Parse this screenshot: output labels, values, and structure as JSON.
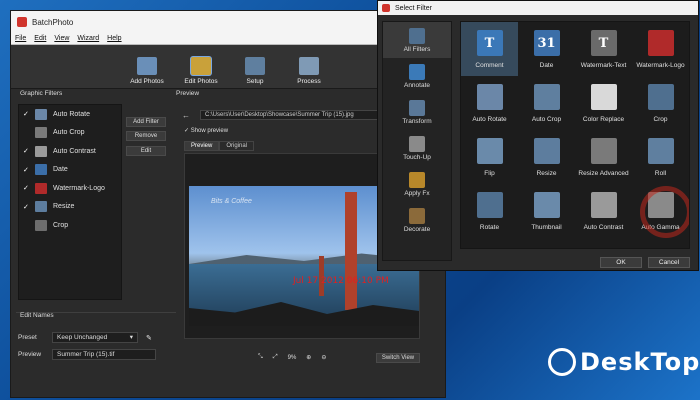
{
  "main_window": {
    "title": "BatchPhoto",
    "menu": [
      "File",
      "Edit",
      "View",
      "Wizard",
      "Help"
    ],
    "toolbar": [
      {
        "label": "Add Photos",
        "icon": "add-photos-icon",
        "color": "#6a8fb8"
      },
      {
        "label": "Edit Photos",
        "icon": "edit-photos-icon",
        "color": "#c9a13a",
        "active": true
      },
      {
        "label": "Setup",
        "icon": "setup-icon",
        "color": "#5f7f9f"
      },
      {
        "label": "Process",
        "icon": "process-icon",
        "color": "#7f9ab5"
      }
    ],
    "graphic_filters_label": "Graphic Filters",
    "filters": [
      {
        "checked": true,
        "name": "Auto Rotate",
        "color": "#6b87a8"
      },
      {
        "checked": false,
        "name": "Auto Crop",
        "color": "#7a7a7a"
      },
      {
        "checked": true,
        "name": "Auto Contrast",
        "color": "#9a9a9a"
      },
      {
        "checked": true,
        "name": "Date",
        "color": "#3b6ea8"
      },
      {
        "checked": true,
        "name": "Watermark-Logo",
        "color": "#b02a2a"
      },
      {
        "checked": true,
        "name": "Resize",
        "color": "#5d7d9e"
      },
      {
        "checked": false,
        "name": "Crop",
        "color": "#6d6d6d"
      }
    ],
    "buttons": {
      "add_filter": "Add Filter",
      "remove": "Remove",
      "edit": "Edit"
    },
    "preview_label": "Preview",
    "path": "C:\\Users\\User\\Desktop\\Showcase\\Summer Trip (15).jpg",
    "show_preview": "Show preview",
    "tabs": [
      "Preview",
      "Original"
    ],
    "photo_watermark": "Bits & Coffee",
    "photo_date": "Jul 17 2012 06:10 PM",
    "zoom": "9%",
    "switch_view": "Switch View",
    "edit_names_label": "Edit Names",
    "preset_label": "Preset",
    "preset_value": "Keep Unchanged",
    "preview_name_label": "Preview",
    "preview_name_value": "Summer Trip (15).tif"
  },
  "dialog": {
    "title": "Select Filter",
    "categories": [
      {
        "label": "All Filters",
        "color": "#4f6f8f",
        "selected": true
      },
      {
        "label": "Annotate",
        "color": "#3b7ab8"
      },
      {
        "label": "Transform",
        "color": "#5a7898"
      },
      {
        "label": "Touch-Up",
        "color": "#8a8a8a"
      },
      {
        "label": "Apply Fx",
        "color": "#b8882a"
      },
      {
        "label": "Decorate",
        "color": "#8b6a3a"
      }
    ],
    "filters": [
      {
        "label": "Comment",
        "glyph": "T",
        "color": "#3b78b8",
        "selected": true
      },
      {
        "label": "Date",
        "glyph": "31",
        "color": "#3b6ea8"
      },
      {
        "label": "Watermark-Text",
        "glyph": "T",
        "color": "#6a6a6a"
      },
      {
        "label": "Watermark-Logo",
        "glyph": "",
        "color": "#b02a2a"
      },
      {
        "label": "Auto Rotate",
        "glyph": "",
        "color": "#6b87a8"
      },
      {
        "label": "Auto Crop",
        "glyph": "",
        "color": "#5f7f9f"
      },
      {
        "label": "Color Replace",
        "glyph": "",
        "color": "#d9d9d9"
      },
      {
        "label": "Crop",
        "glyph": "",
        "color": "#4f6f8f"
      },
      {
        "label": "Flip",
        "glyph": "",
        "color": "#6a8aaa"
      },
      {
        "label": "Resize",
        "glyph": "",
        "color": "#5d7d9e"
      },
      {
        "label": "Resize Advanced",
        "glyph": "",
        "color": "#7a7a7a"
      },
      {
        "label": "Roll",
        "glyph": "",
        "color": "#5f7f9f"
      },
      {
        "label": "Rotate",
        "glyph": "",
        "color": "#4f6f8f"
      },
      {
        "label": "Thumbnail",
        "glyph": "",
        "color": "#6a8aaa"
      },
      {
        "label": "Auto Contrast",
        "glyph": "",
        "color": "#9a9a9a"
      },
      {
        "label": "Auto Gamma",
        "glyph": "",
        "color": "#8a8a8a",
        "highlight": true
      }
    ],
    "ok": "OK",
    "cancel": "Cancel"
  },
  "site_watermark": "DeskTop"
}
